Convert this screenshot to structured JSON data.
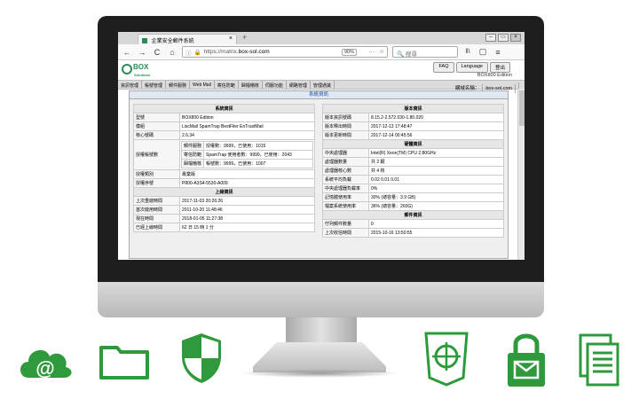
{
  "browser": {
    "tab_title": "企業安全郵件系統",
    "tab_close": "×",
    "new_tab": "+",
    "url_prefix": "https://matrix.",
    "url_domain": "box-sol.com",
    "zoom": "90%",
    "search_placeholder": "搜尋",
    "back": "←",
    "forward": "→",
    "reload": "C",
    "home": "⌂",
    "more": "···",
    "bookmark": "☆",
    "menu": "≡",
    "library": "|||\\",
    "sidebar": "▢"
  },
  "app": {
    "logo_text": "BOX",
    "logo_sub": "Solutions",
    "buttons": [
      "FAQ",
      "Language",
      "登出"
    ],
    "edition": "BOX800 Edition",
    "hostname_label": "網域名稱：",
    "hostname": "box-sol.com",
    "menu": [
      "資訊管理",
      "帳號管理",
      "郵件服務",
      "Web Mail",
      "寄信防範",
      "歸檔稽核",
      "伺服功能",
      "網路管理",
      "管理通識"
    ],
    "content_title": "系統資訊"
  },
  "left_panel": {
    "section1": "系統資訊",
    "rows": [
      {
        "k": "型號",
        "v": "BOX800 Edition"
      },
      {
        "k": "模組",
        "v": "LiscMail SpamTrap BestFiler EnTrustMail"
      },
      {
        "k": "核心號碼",
        "v": "2.6.34"
      }
    ],
    "license_label": "授權帳號數",
    "license_rows": [
      {
        "k": "郵件服務",
        "v": "授權數：9999，已使用：1015"
      },
      {
        "k": "寄信防範",
        "v": "SpamTrap 使用者數：9999，已使用：2043"
      },
      {
        "k": "歸檔稽核",
        "v": "帳號數：9999，已使用：1007"
      }
    ],
    "rows2": [
      {
        "k": "授權類別",
        "v": "專業版"
      },
      {
        "k": "授權序號",
        "v": "P800-A3S4-5530-A009"
      }
    ],
    "section2": "上線資訊",
    "rows3": [
      {
        "k": "上次重啟時間",
        "v": "2017-11-03 20:26:26"
      },
      {
        "k": "首次啟用時間",
        "v": "2011-10-20 11:48:46"
      },
      {
        "k": "現在時間",
        "v": "2018-01-05 11:27:38"
      },
      {
        "k": "已經上線時間",
        "v": "62 日 15 時 1 分"
      }
    ]
  },
  "right_panel": {
    "section1": "版本資訊",
    "rows": [
      {
        "k": "版本資訊號碼",
        "v": "8.15.2-2.572.030-1.80.020"
      },
      {
        "k": "版本釋出時間",
        "v": "2017-12-13 17:48:47"
      },
      {
        "k": "版本更新時間",
        "v": "2017-12-14 00:45:56"
      }
    ],
    "section2": "硬體資訊",
    "rows2": [
      {
        "k": "中央處理器",
        "v": "Intel(R) Xeon(TM) CPU 2.80GHz"
      },
      {
        "k": "處理器數量",
        "v": "共 2 顆"
      },
      {
        "k": "處理器核心數",
        "v": "共 4 核"
      },
      {
        "k": "系統平均負載",
        "v": "0.02 0.01 0.01"
      },
      {
        "k": "中央處理器負載率",
        "v": "0%"
      },
      {
        "k": "記憶體使用率",
        "v": "30% (總容量：3.9 GB)"
      },
      {
        "k": "檔案系統使用率",
        "v": "36% (總容量：260G)"
      }
    ],
    "section3": "郵件資訊",
    "rows3": [
      {
        "k": "佇列郵件數量",
        "v": "0"
      },
      {
        "k": "上次收信時間",
        "v": "2015-10-16 13:50:55"
      }
    ]
  },
  "icons": {
    "color": "#2e9a3c",
    "names": [
      "email-cloud-icon",
      "folder-icon",
      "shield-icon",
      "target-file-icon",
      "lock-mail-icon",
      "documents-icon"
    ]
  }
}
